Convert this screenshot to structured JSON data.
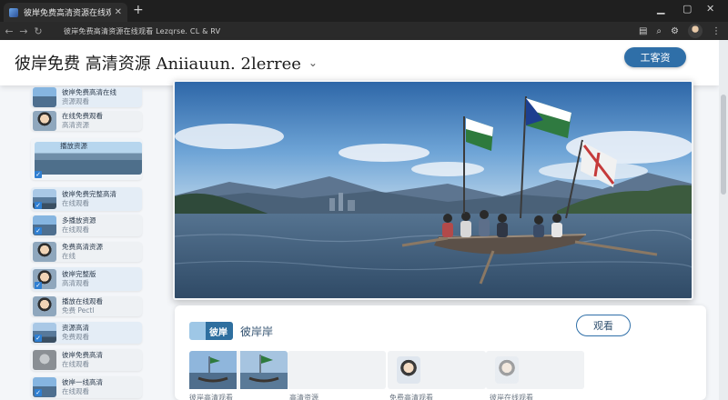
{
  "browser": {
    "tab_title": "彼岸免费高清资源在线观看",
    "tab_close": "✕",
    "new_tab": "+",
    "url": "彼岸免费高清资源在线观看 Lezqrse. CL & RV"
  },
  "header": {
    "site_title": "彼岸免费 高清资源 Aniiauun. 2lerree",
    "chevron": "⌄",
    "tool_button": "工客资"
  },
  "sidebar": {
    "items": [
      {
        "l1": "彼岸免费高清在线",
        "l2": "资源观看"
      },
      {
        "l1": "在线免费观看",
        "l2": "高清资源"
      },
      {
        "l1": "播放资源"
      },
      {
        "l1": "彼岸免费完整高清",
        "l2": "在线观看"
      },
      {
        "l1": "多播放资源",
        "l2": "在线观看"
      },
      {
        "l1": "免费高清资源",
        "l2": "在线"
      },
      {
        "l1": "彼岸完整版",
        "l2": "高清观看"
      },
      {
        "l1": "播放在线观看",
        "l2": "免费 Pectl"
      },
      {
        "l1": "资源高清",
        "l2": "免费观看"
      },
      {
        "l1": "彼岸免费高清",
        "l2": "在线观看"
      },
      {
        "l1": "彼岸一线高清",
        "l2": "在线观看"
      }
    ]
  },
  "card": {
    "badge": "彼岸",
    "title": "彼岸岸",
    "watch_button": "观看",
    "thumbs": [
      {
        "label": "彼岸高清观看"
      },
      {
        "label": "高清资源"
      },
      {
        "label": "免费高清观看"
      },
      {
        "label": "彼岸在线观看"
      }
    ]
  },
  "colors": {
    "accent": "#2f6fa8",
    "header_bg": "#ffffff",
    "chrome_bg": "#1f1f1f"
  }
}
